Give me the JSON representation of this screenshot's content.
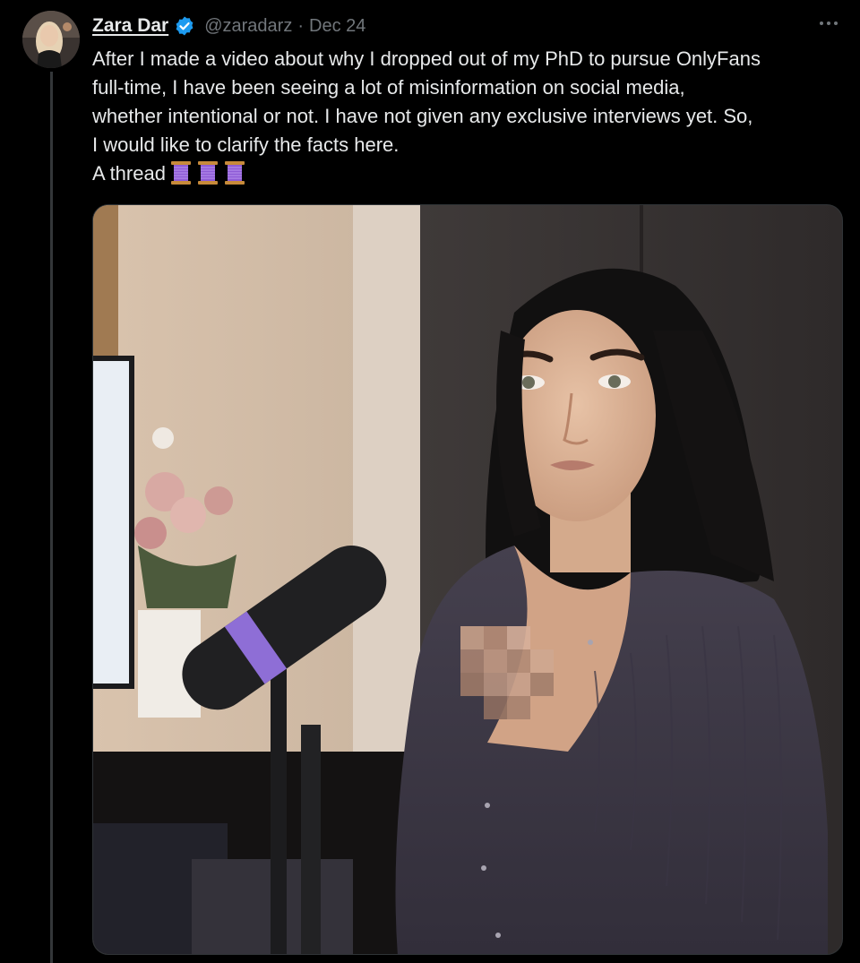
{
  "tweet": {
    "author": {
      "display_name": "Zara Dar",
      "handle": "@zaradarz",
      "verified": true
    },
    "separator": "·",
    "date": "Dec 24",
    "text_lines": [
      "After I made a video about why I dropped out of my PhD to pursue OnlyFans",
      "full-time, I have been seeing a lot of misinformation on social media,",
      "whether intentional or not. I have not given any exclusive interviews yet. So,",
      "I would like to clarify the facts here.",
      "A thread"
    ],
    "emoji_icons": [
      "spool-icon",
      "spool-icon",
      "spool-icon"
    ],
    "colors": {
      "background": "#000000",
      "text": "#e7e9ea",
      "secondary": "#71767b",
      "verified": "#1d9bf0",
      "thread_line": "#333639"
    },
    "icons": {
      "more": "more-horizontal-icon",
      "verified": "verified-badge-icon"
    }
  }
}
